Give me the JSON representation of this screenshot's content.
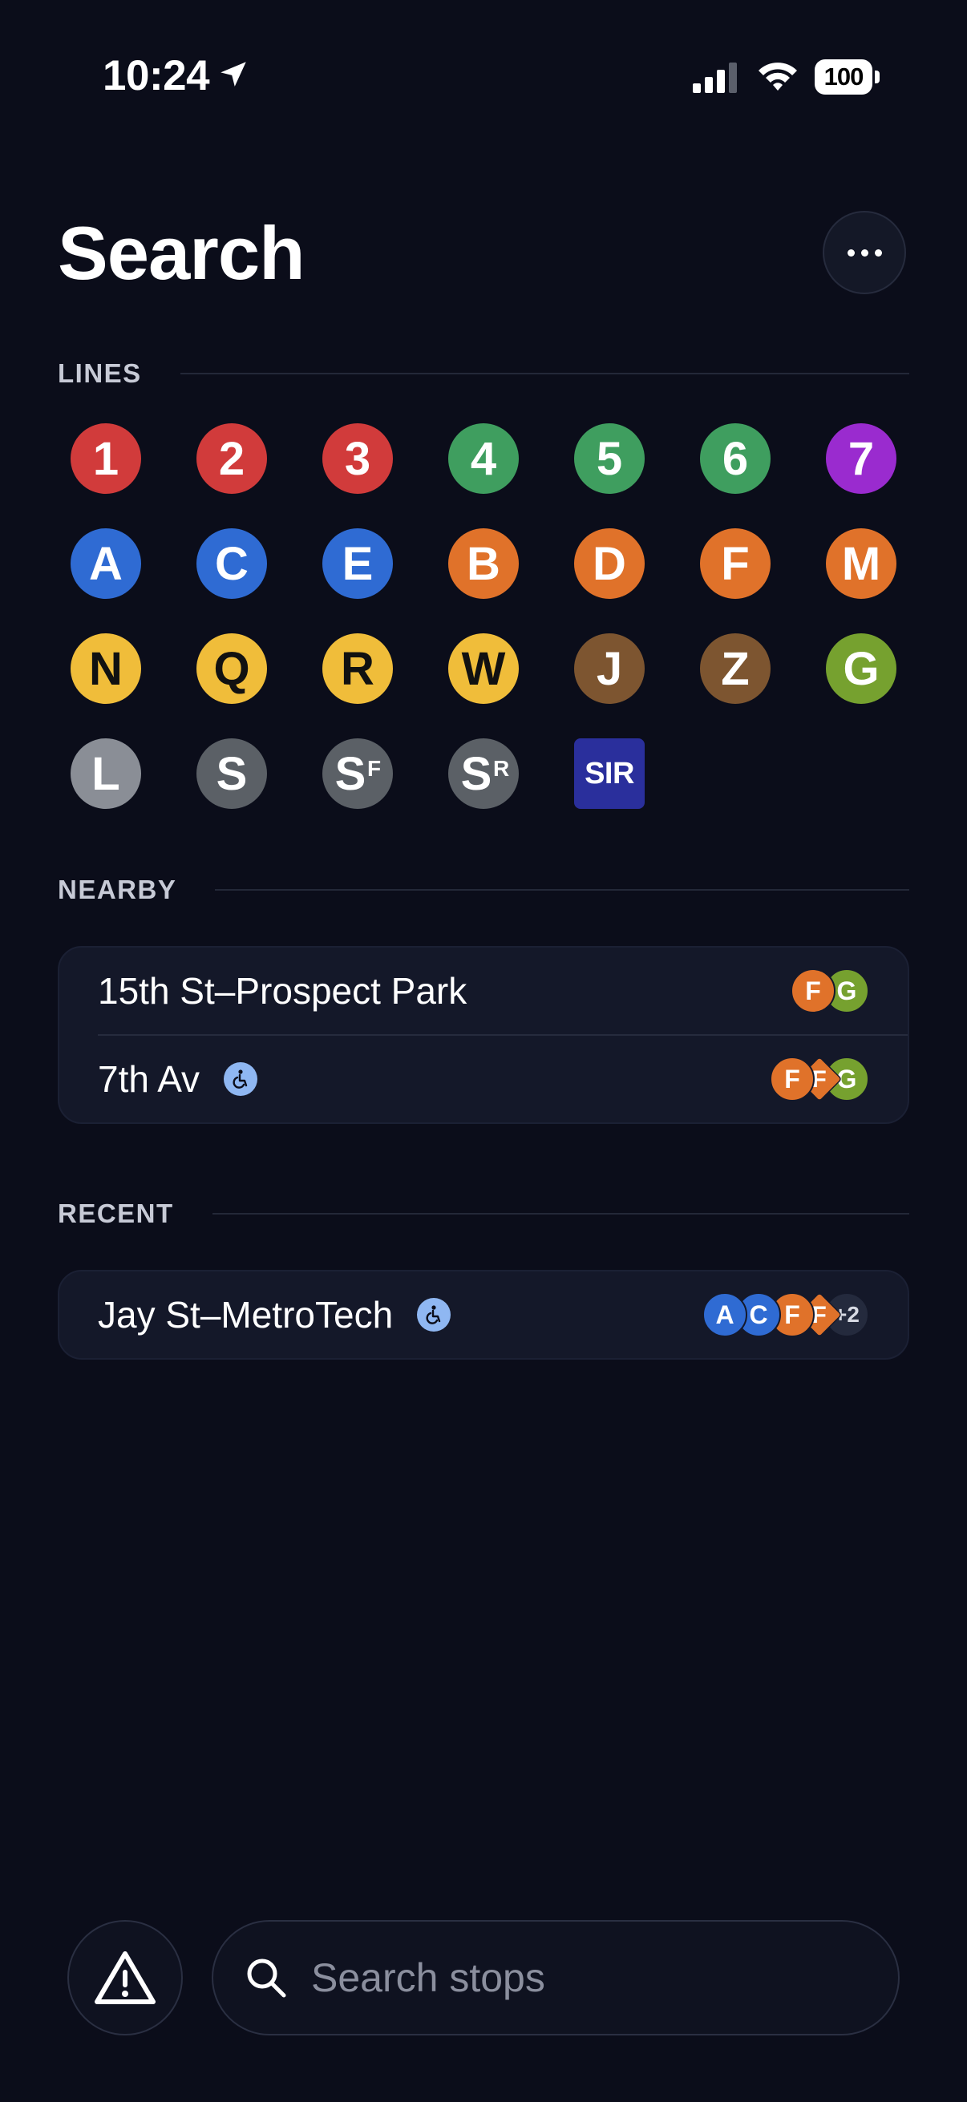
{
  "status_bar": {
    "time": "10:24",
    "battery": "100"
  },
  "header": {
    "title": "Search"
  },
  "sections": {
    "lines": "LINES",
    "nearby": "NEARBY",
    "recent": "RECENT"
  },
  "lines": [
    [
      {
        "label": "1",
        "color": "#d13b3b"
      },
      {
        "label": "2",
        "color": "#d13b3b"
      },
      {
        "label": "3",
        "color": "#d13b3b"
      },
      {
        "label": "4",
        "color": "#3f9e5f"
      },
      {
        "label": "5",
        "color": "#3f9e5f"
      },
      {
        "label": "6",
        "color": "#3f9e5f"
      },
      {
        "label": "7",
        "color": "#9a2bcf"
      }
    ],
    [
      {
        "label": "A",
        "color": "#2f6bd3"
      },
      {
        "label": "C",
        "color": "#2f6bd3"
      },
      {
        "label": "E",
        "color": "#2f6bd3"
      },
      {
        "label": "B",
        "color": "#e0722a"
      },
      {
        "label": "D",
        "color": "#e0722a"
      },
      {
        "label": "F",
        "color": "#e0722a"
      },
      {
        "label": "M",
        "color": "#e0722a"
      }
    ],
    [
      {
        "label": "N",
        "color": "#f0bd3a",
        "dark": true
      },
      {
        "label": "Q",
        "color": "#f0bd3a",
        "dark": true
      },
      {
        "label": "R",
        "color": "#f0bd3a",
        "dark": true
      },
      {
        "label": "W",
        "color": "#f0bd3a",
        "dark": true
      },
      {
        "label": "J",
        "color": "#7d5530"
      },
      {
        "label": "Z",
        "color": "#7d5530"
      },
      {
        "label": "G",
        "color": "#76a12f"
      }
    ],
    [
      {
        "label": "L",
        "color": "#8a8e96"
      },
      {
        "label": "S",
        "color": "#5b6066"
      },
      {
        "label": "S",
        "sup": "F",
        "color": "#5b6066"
      },
      {
        "label": "S",
        "sup": "R",
        "color": "#5b6066"
      },
      {
        "label": "SIR",
        "color": "#2a2f9c",
        "shape": "square"
      }
    ]
  ],
  "nearby": [
    {
      "name": "15th St–Prospect Park",
      "accessible": false,
      "routes": [
        {
          "label": "F",
          "color": "#e0722a"
        },
        {
          "label": "G",
          "color": "#76a12f"
        }
      ]
    },
    {
      "name": "7th Av",
      "accessible": true,
      "routes": [
        {
          "label": "F",
          "color": "#e0722a"
        },
        {
          "label": "F",
          "color": "#e0722a",
          "diamond": true
        },
        {
          "label": "G",
          "color": "#76a12f"
        }
      ]
    }
  ],
  "recent": [
    {
      "name": "Jay St–MetroTech",
      "accessible": true,
      "routes": [
        {
          "label": "A",
          "color": "#2f6bd3"
        },
        {
          "label": "C",
          "color": "#2f6bd3"
        },
        {
          "label": "F",
          "color": "#e0722a"
        },
        {
          "label": "F",
          "color": "#e0722a",
          "diamond": true
        }
      ],
      "more": "+2"
    }
  ],
  "search": {
    "placeholder": "Search stops"
  },
  "icons": {
    "location": "location-arrow-icon",
    "signal": "cellular-signal-icon",
    "wifi": "wifi-icon",
    "more": "ellipsis-icon",
    "alert": "warning-triangle-icon",
    "search": "search-icon",
    "accessible": "wheelchair-icon"
  }
}
